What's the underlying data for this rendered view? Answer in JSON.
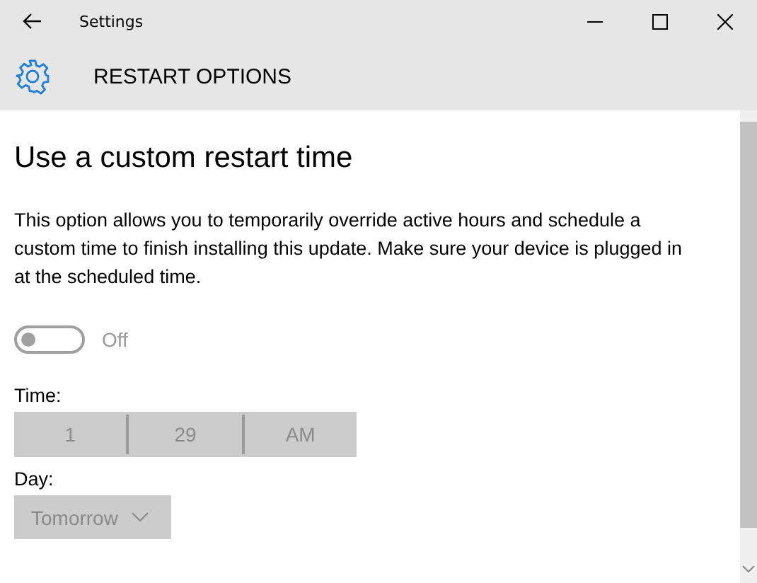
{
  "window": {
    "title": "Settings"
  },
  "header": {
    "title": "RESTART OPTIONS"
  },
  "content": {
    "heading": "Use a custom restart time",
    "description": "This option allows you to temporarily override active hours and schedule a custom time to finish installing this update. Make sure your device is plugged in at the scheduled time.",
    "toggle": {
      "on": false,
      "label": "Off"
    },
    "time": {
      "label": "Time:",
      "disabled": true,
      "parts": [
        "1",
        "29",
        "AM"
      ]
    },
    "day": {
      "label": "Day:",
      "disabled": true,
      "value": "Tomorrow"
    }
  }
}
